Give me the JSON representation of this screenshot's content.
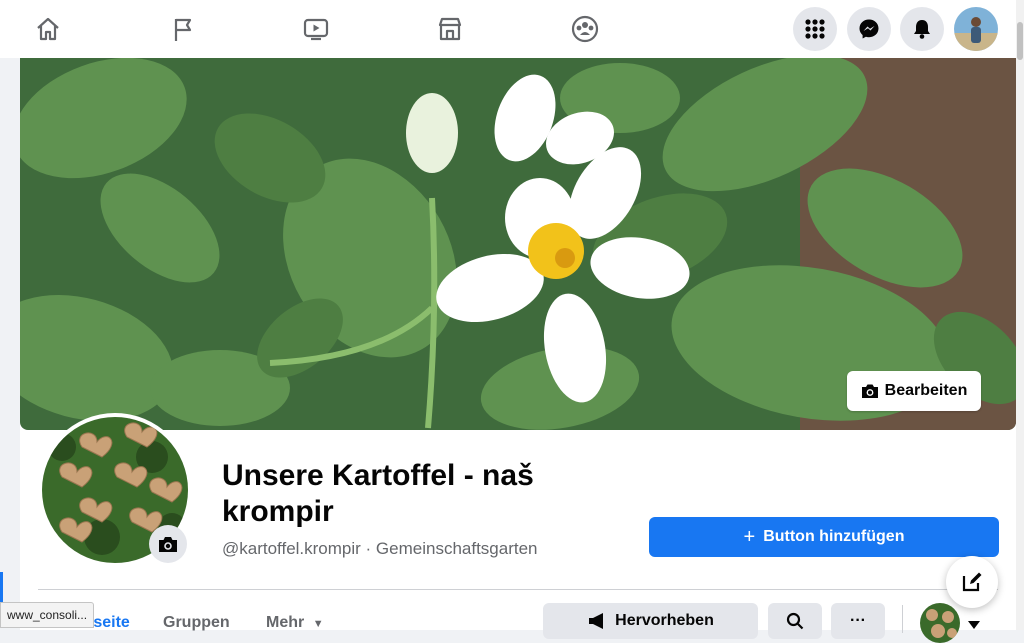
{
  "nav": {
    "icons": [
      "home-icon",
      "flag-icon",
      "watch-icon",
      "marketplace-icon",
      "groups-icon"
    ],
    "right_icons": [
      "menu-grid-icon",
      "messenger-icon",
      "bell-icon"
    ]
  },
  "cover": {
    "edit_label": "Bearbeiten"
  },
  "profile": {
    "name": "Unsere Kartoffel - naš krompir",
    "subtitle": "@kartoffel.krompir · Gemeinschaftsgarten"
  },
  "actions": {
    "add_button_label": "Button hinzufügen",
    "promote_label": "Hervorheben",
    "more_label": "···"
  },
  "tabs": [
    {
      "label": "tseite",
      "active": true
    },
    {
      "label": "Gruppen",
      "active": false
    },
    {
      "label": "Mehr",
      "active": false
    }
  ],
  "status_tooltip": "www_consoli...",
  "colors": {
    "brand_blue": "#1877f2",
    "secondary_text": "#65676b",
    "button_grey": "#e4e6eb"
  }
}
